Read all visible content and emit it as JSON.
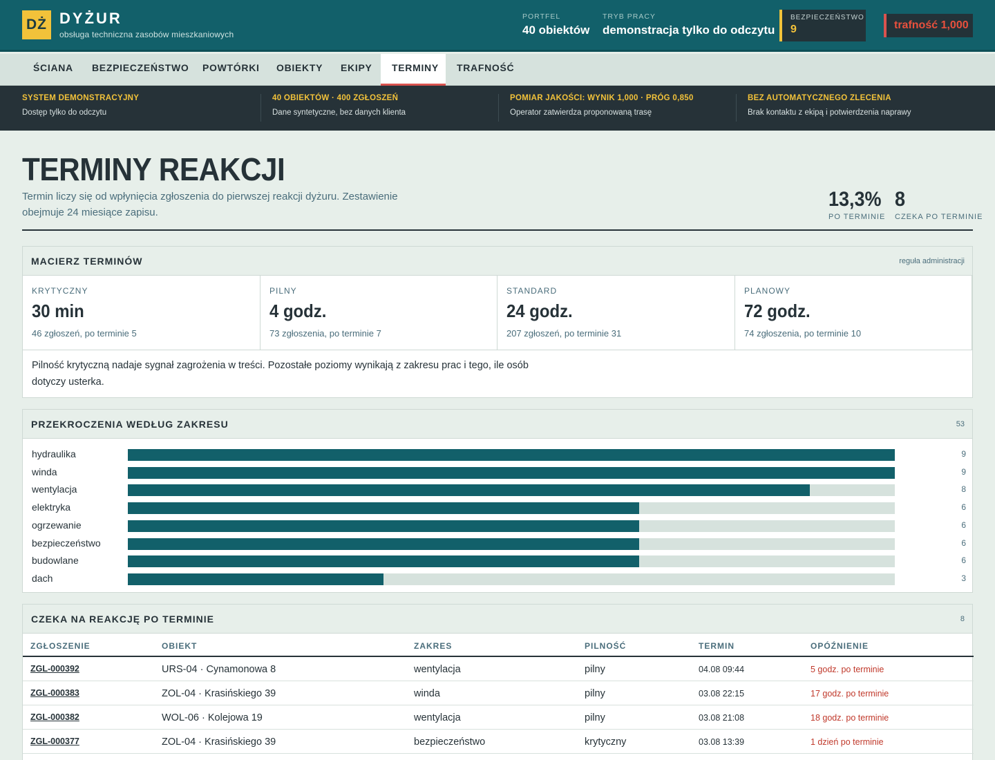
{
  "header": {
    "logo": "DŻ",
    "brand": "DYŻUR",
    "subtitle": "obsługa techniczna zasobów mieszkaniowych",
    "portfel_label": "PORTFEL",
    "portfel_value": "40 obiektów",
    "tryb_label": "TRYB PRACY",
    "tryb_value": "demonstracja tylko do odczytu",
    "safety_label": "BEZPIECZEŃSTWO",
    "safety_value": "9",
    "accuracy": "trafność 1,000"
  },
  "nav": [
    {
      "label": "ŚCIANA"
    },
    {
      "label": "BEZPIECZEŃSTWO"
    },
    {
      "label": "POWTÓRKI"
    },
    {
      "label": "OBIEKTY"
    },
    {
      "label": "EKIPY"
    },
    {
      "label": "TERMINY"
    },
    {
      "label": "TRAFNOŚĆ"
    }
  ],
  "strip": [
    {
      "title": "SYSTEM DEMONSTRACYJNY",
      "desc": "Dostęp tylko do odczytu"
    },
    {
      "title": "40 OBIEKTÓW · 400 ZGŁOSZEŃ",
      "desc": "Dane syntetyczne, bez danych klienta"
    },
    {
      "title": "POMIAR JAKOŚCI: WYNIK 1,000 · PRÓG 0,850",
      "desc": "Operator zatwierdza proponowaną trasę"
    },
    {
      "title": "BEZ AUTOMATYCZNEGO ZLECENIA",
      "desc": "Brak kontaktu z ekipą i potwierdzenia naprawy"
    }
  ],
  "page": {
    "title": "TERMINY REAKCJI",
    "desc": "Termin liczy się od wpłynięcia zgłoszenia do pierwszej reakcji dyżuru. Zestawienie obejmuje 24 miesiące zapisu.",
    "kpi1_value": "13,3%",
    "kpi1_label": "PO TERMINIE",
    "kpi2_value": "8",
    "kpi2_label": "CZEKA PO TERMINIE"
  },
  "matrix": {
    "title": "MACIERZ TERMINÓW",
    "meta": "reguła administracji",
    "cells": [
      {
        "level": "KRYTYCZNY",
        "time": "30 min",
        "stats": "46 zgłoszeń, po terminie 5"
      },
      {
        "level": "PILNY",
        "time": "4 godz.",
        "stats": "73 zgłoszenia, po terminie 7"
      },
      {
        "level": "STANDARD",
        "time": "24 godz.",
        "stats": "207 zgłoszeń, po terminie 31"
      },
      {
        "level": "PLANOWY",
        "time": "72 godz.",
        "stats": "74 zgłoszenia, po terminie 10"
      }
    ],
    "note": "Pilność krytyczną nadaje sygnał zagrożenia w treści. Pozostałe poziomy wynikają z zakresu prac i tego, ile osób dotyczy usterka."
  },
  "breaches": {
    "title": "PRZEKROCZENIA WEDŁUG ZAKRESU",
    "total": "53",
    "rows": [
      {
        "label": "hydraulika",
        "value": "9"
      },
      {
        "label": "winda",
        "value": "9"
      },
      {
        "label": "wentylacja",
        "value": "8"
      },
      {
        "label": "elektryka",
        "value": "6"
      },
      {
        "label": "ogrzewanie",
        "value": "6"
      },
      {
        "label": "bezpieczeństwo",
        "value": "6"
      },
      {
        "label": "budowlane",
        "value": "6"
      },
      {
        "label": "dach",
        "value": "3"
      }
    ]
  },
  "chart_data": {
    "type": "bar",
    "categories": [
      "hydraulika",
      "winda",
      "wentylacja",
      "elektryka",
      "ogrzewanie",
      "bezpieczeństwo",
      "budowlane",
      "dach"
    ],
    "values": [
      9,
      9,
      8,
      6,
      6,
      6,
      6,
      3
    ],
    "title": "PRZEKROCZENIA WEDŁUG ZAKRESU",
    "xlim": [
      0,
      9
    ]
  },
  "overdue": {
    "title": "CZEKA NA REAKCJĘ PO TERMINIE",
    "count": "8",
    "columns": [
      "ZGŁOSZENIE",
      "OBIEKT",
      "ZAKRES",
      "PILNOŚĆ",
      "TERMIN",
      "OPÓŹNIENIE"
    ],
    "rows": [
      {
        "id": "ZGL-000392",
        "object": "URS-04 · Cynamonowa 8",
        "scope": "wentylacja",
        "urgency": "pilny",
        "term": "04.08 09:44",
        "delay": "5 godz. po terminie"
      },
      {
        "id": "ZGL-000383",
        "object": "ZOL-04 · Krasińskiego 39",
        "scope": "winda",
        "urgency": "pilny",
        "term": "03.08 22:15",
        "delay": "17 godz. po terminie"
      },
      {
        "id": "ZGL-000382",
        "object": "WOL-06 · Kolejowa 19",
        "scope": "wentylacja",
        "urgency": "pilny",
        "term": "03.08 21:08",
        "delay": "18 godz. po terminie"
      },
      {
        "id": "ZGL-000377",
        "object": "ZOL-04 · Krasińskiego 39",
        "scope": "bezpieczeństwo",
        "urgency": "krytyczny",
        "term": "03.08 13:39",
        "delay": "1 dzień po terminie"
      }
    ]
  }
}
